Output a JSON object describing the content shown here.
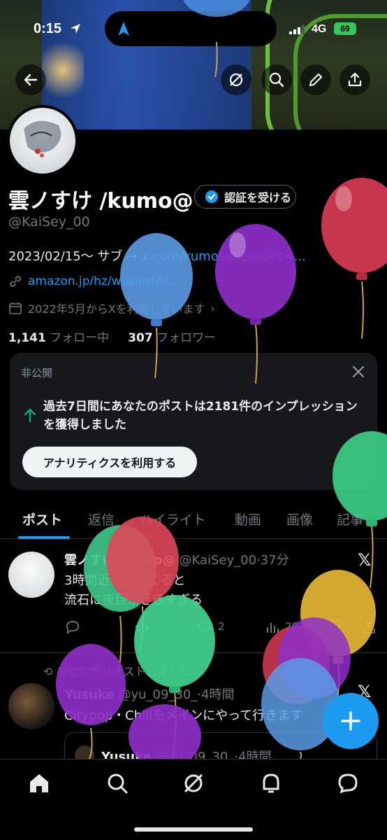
{
  "status_bar": {
    "time": "0:15",
    "network": "4G",
    "battery": "69"
  },
  "profile": {
    "name": "雲ノすけ /kumo@",
    "verify_label": "認証を受ける",
    "handle": "@KaiSey_00",
    "bio_prefix": "2023/02/15～ サブ → ",
    "bio_link": "x.com/kumosukesub?s=...",
    "website": "amazon.jp/hz/wishlist/ls...",
    "joined": "2022年5月からXを利用しています",
    "following_count": "1,141",
    "following_label": "フォロー中",
    "followers_count": "307",
    "followers_label": "フォロワー"
  },
  "analytics_card": {
    "label": "非公開",
    "text": "過去7日間にあなたのポストは2181件のインプレッションを獲得しました",
    "button": "アナリティクスを利用する"
  },
  "tabs": [
    "ポスト",
    "返信",
    "ハイライト",
    "動画",
    "画像",
    "記事"
  ],
  "posts": [
    {
      "name": "雲ノすけ /kumo@",
      "handle": "@KaiSey_00",
      "time": "·37分",
      "line1": "3時間近く星見てると",
      "line2": "流石に夜目がききすぎる",
      "likes": "2",
      "views": "20"
    },
    {
      "repost_label": "あなたがリポストしました",
      "name": "Yusuke",
      "handle": "@yu_09_30_",
      "time": "·4時間",
      "text": "Citypop・Chillをメインにやって行きます",
      "quote_name": "Yusuke",
      "quote_handle": "@yu_09_30_",
      "quote_time": "·4時間"
    }
  ],
  "colors": {
    "accent": "#1d9bf0",
    "background": "#000000",
    "muted": "#71767b"
  },
  "icons": [
    "back-arrow-icon",
    "grok-icon",
    "search-icon",
    "pencil-icon",
    "share-icon",
    "x-logo-icon",
    "home-icon",
    "notifications-icon",
    "messages-icon",
    "compose-icon"
  ]
}
